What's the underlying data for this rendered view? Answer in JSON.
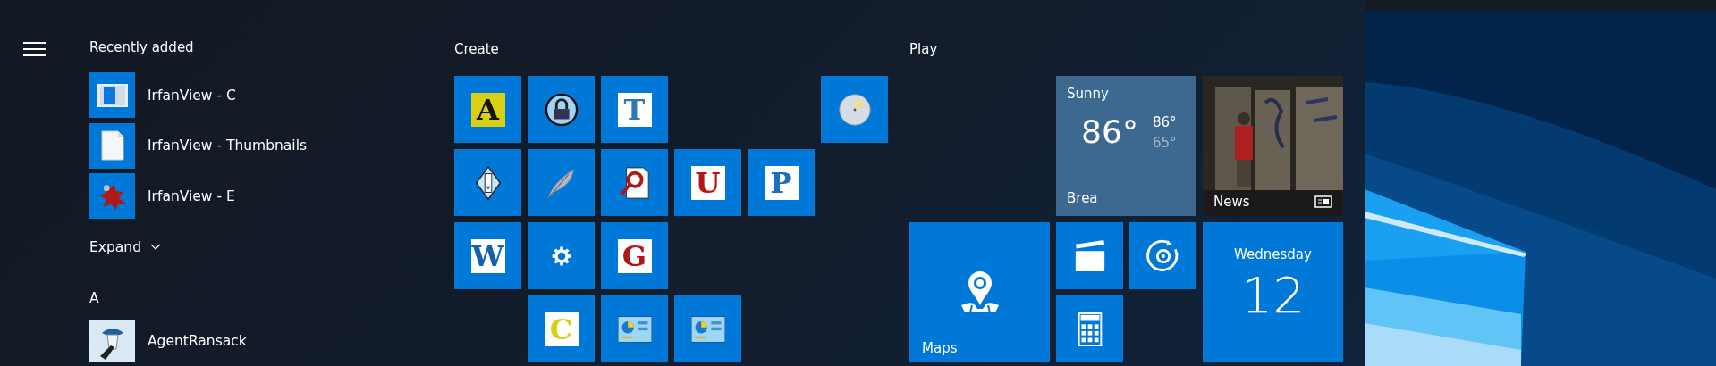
{
  "recently_added": {
    "title": "Recently added",
    "items": [
      {
        "label": "IrfanView - C"
      },
      {
        "label": "IrfanView - Thumbnails"
      },
      {
        "label": "IrfanView - E"
      }
    ],
    "expand": {
      "label": "Expand"
    }
  },
  "app_list": {
    "sections": [
      {
        "letter": "A",
        "items": [
          {
            "label": "AgentRansack"
          }
        ]
      }
    ]
  },
  "groups": [
    {
      "title": "Create",
      "tiles": [
        {
          "kind": "letter",
          "glyph": "A"
        },
        {
          "kind": "lock"
        },
        {
          "kind": "letter",
          "glyph": "T"
        },
        {
          "kind": "clock"
        },
        {
          "kind": "diamond"
        },
        {
          "kind": "feather"
        },
        {
          "kind": "search-doc"
        },
        {
          "kind": "letter",
          "glyph": "U"
        },
        {
          "kind": "letter",
          "glyph": "P"
        },
        {
          "kind": "letter",
          "glyph": "W"
        },
        {
          "kind": "gear"
        },
        {
          "kind": "letter",
          "glyph": "G"
        },
        {
          "kind": "letter",
          "glyph": "C"
        },
        {
          "kind": "panel"
        },
        {
          "kind": "panel"
        }
      ]
    },
    {
      "title": "Play",
      "tiles": [
        {
          "kind": "weather",
          "condition": "Sunny",
          "temperature": "86°",
          "high": "86°",
          "low": "65°",
          "place": "Brea"
        },
        {
          "kind": "news",
          "label": "News"
        },
        {
          "kind": "maps",
          "label": "Maps"
        },
        {
          "kind": "film"
        },
        {
          "kind": "groove"
        },
        {
          "kind": "calculator"
        },
        {
          "kind": "calendar",
          "day": "Wednesday",
          "date": "12"
        }
      ]
    }
  ]
}
